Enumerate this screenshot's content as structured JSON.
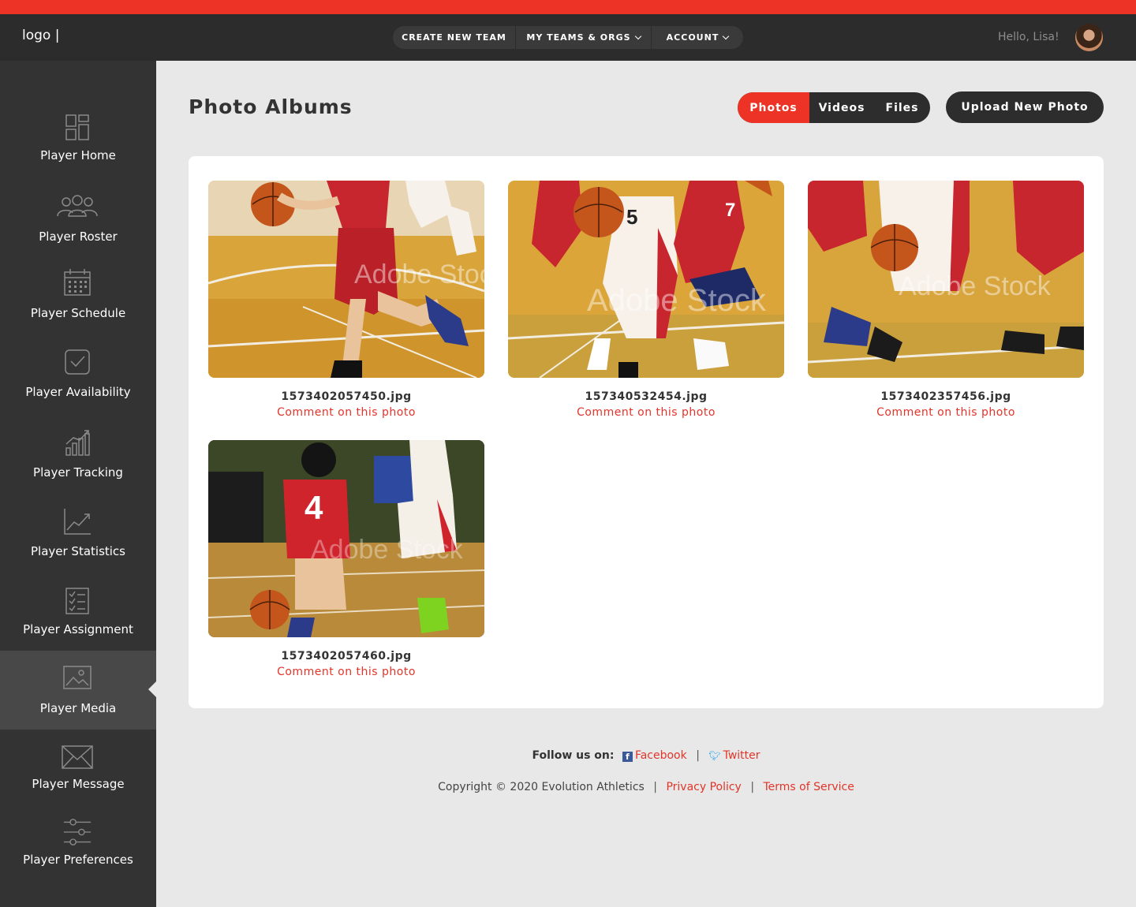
{
  "header": {
    "logo": "logo |",
    "nav": [
      {
        "label": "CREATE NEW TEAM"
      },
      {
        "label": "MY TEAMS & ORGS"
      },
      {
        "label": "ACCOUNT"
      }
    ],
    "greeting": "Hello, Lisa!"
  },
  "sidebar": {
    "items": [
      {
        "label": "Player Home",
        "icon": "dashboard-icon"
      },
      {
        "label": "Player Roster",
        "icon": "users-icon"
      },
      {
        "label": "Player Schedule",
        "icon": "calendar-icon"
      },
      {
        "label": "Player Availability",
        "icon": "checkbox-icon"
      },
      {
        "label": "Player Tracking",
        "icon": "bar-chart-icon"
      },
      {
        "label": "Player Statistics",
        "icon": "line-chart-icon"
      },
      {
        "label": "Player Assignment",
        "icon": "checklist-icon"
      },
      {
        "label": "Player Media",
        "icon": "image-icon",
        "active": true
      },
      {
        "label": "Player Message",
        "icon": "envelope-icon"
      },
      {
        "label": "Player Preferences",
        "icon": "sliders-icon"
      }
    ]
  },
  "main": {
    "title": "Photo Albums",
    "tabs": [
      {
        "label": "Photos",
        "active": true
      },
      {
        "label": "Videos"
      },
      {
        "label": "Files"
      }
    ],
    "upload_label": "Upload New Photo",
    "photos": [
      {
        "filename": "1573402057450.jpg",
        "comment": "Comment on this photo",
        "watermark": "Adobe Stock"
      },
      {
        "filename": "157340532454.jpg",
        "comment": "Comment on this photo",
        "watermark": "Adobe Stock"
      },
      {
        "filename": "1573402357456.jpg",
        "comment": "Comment on this photo",
        "watermark": "Adobe Stock"
      },
      {
        "filename": "1573402057460.jpg",
        "comment": "Comment on this photo",
        "watermark": "Adobe Stock"
      }
    ]
  },
  "footer": {
    "follow_label": "Follow us on:",
    "facebook": "Facebook",
    "twitter": "Twitter",
    "copyright": "Copyright © 2020 Evolution Athletics",
    "privacy": "Privacy Policy",
    "terms": "Terms of Service"
  },
  "colors": {
    "accent": "#ec3325",
    "dark": "#2c2c2c",
    "sidebar": "#333333",
    "background": "#e8e8e8"
  }
}
